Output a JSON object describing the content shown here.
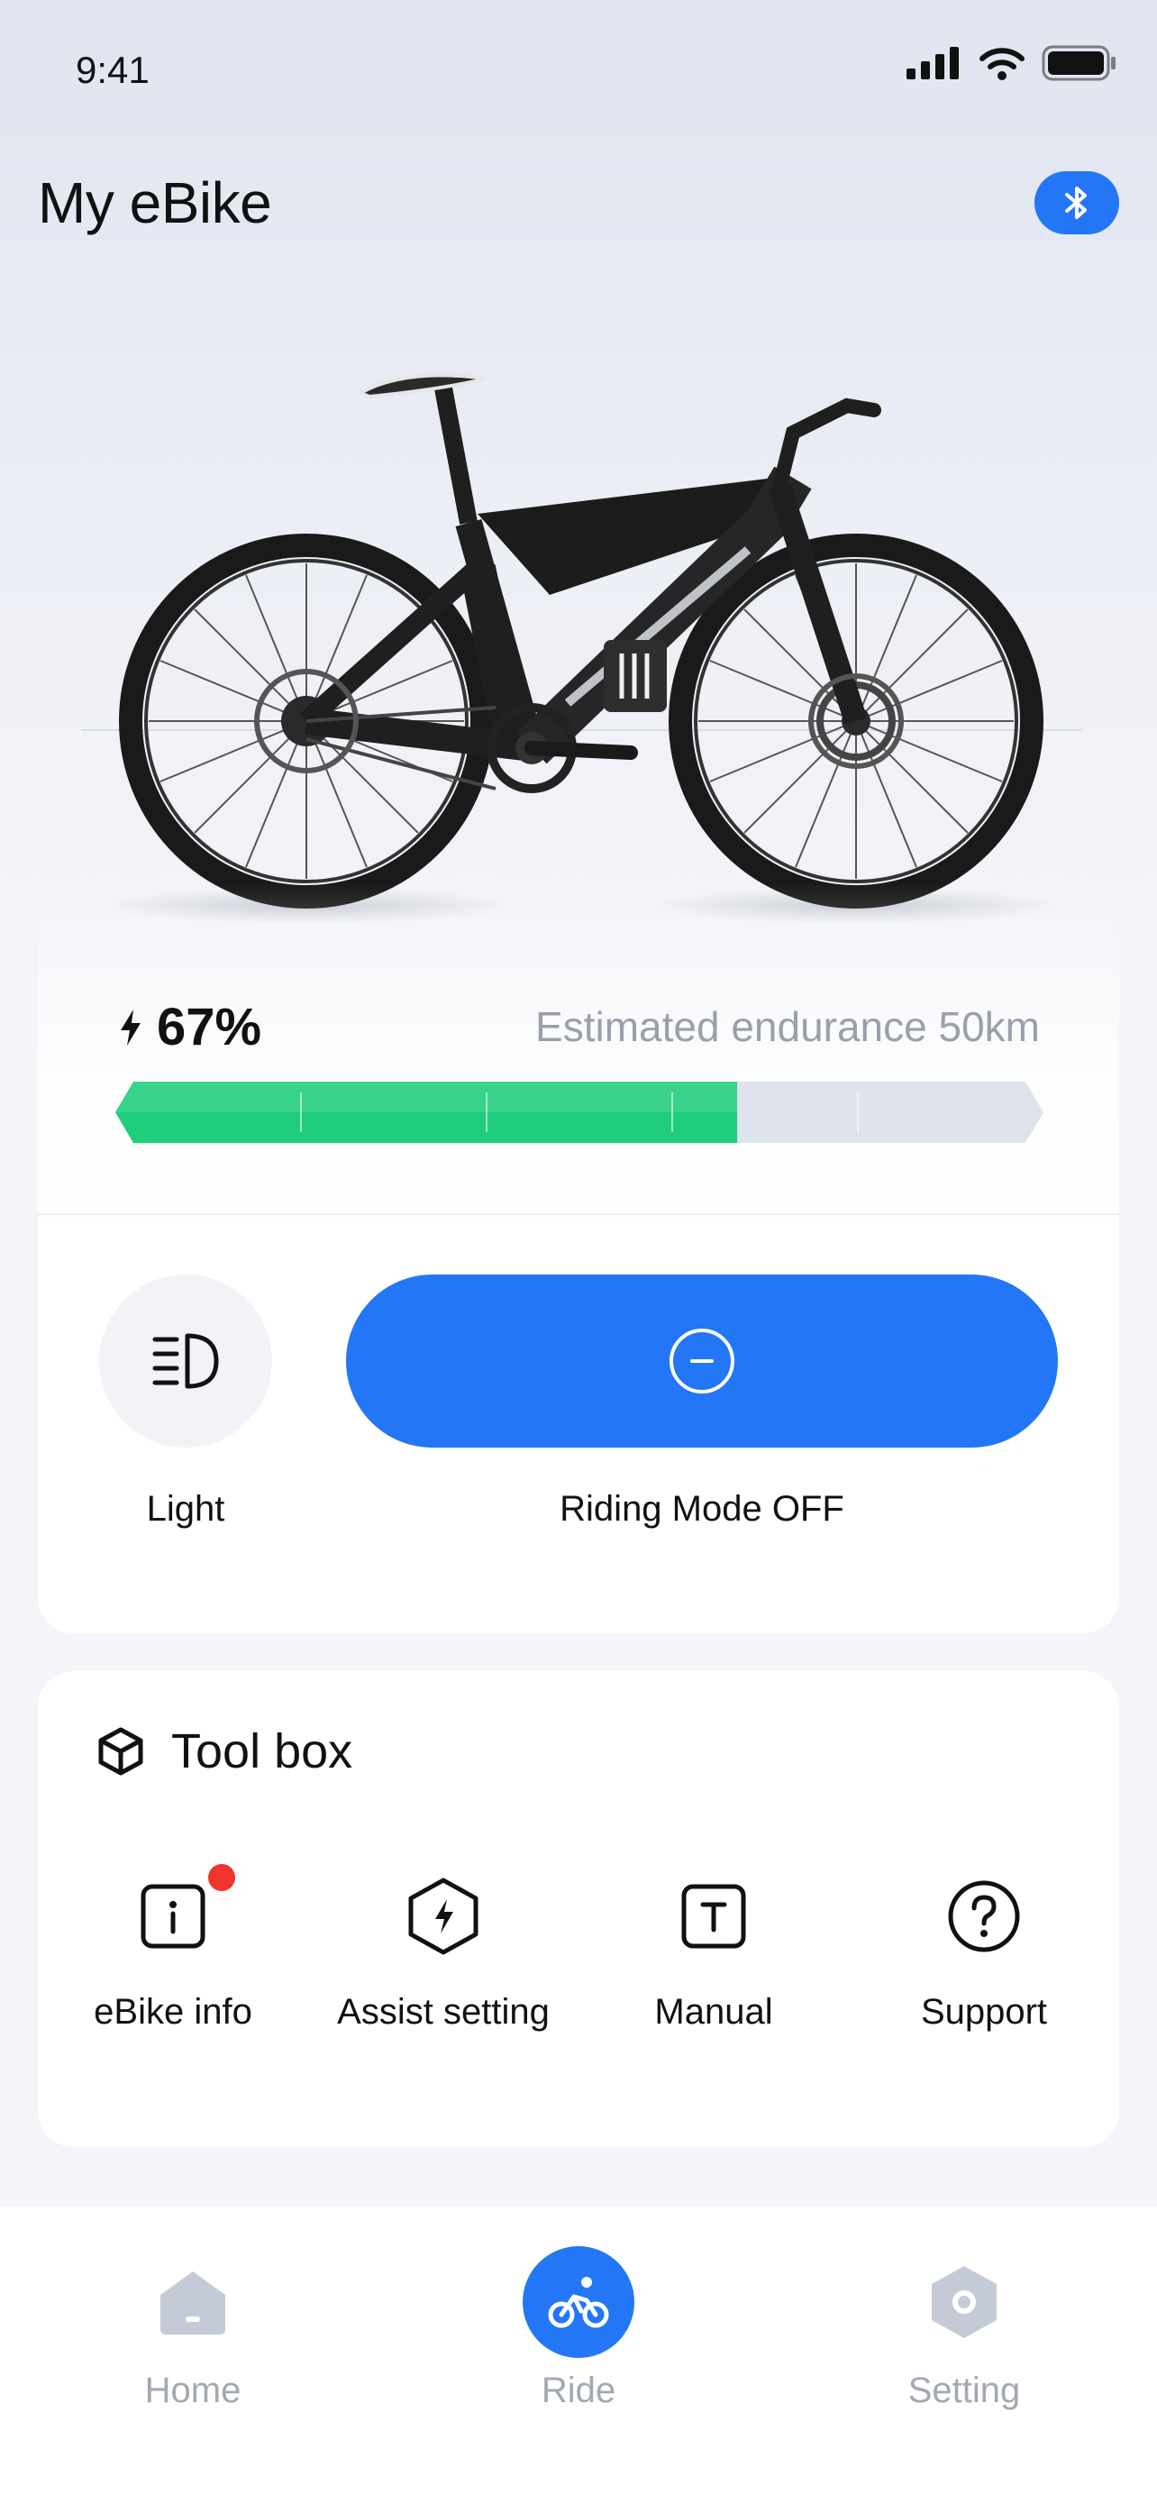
{
  "status": {
    "time": "9:41"
  },
  "header": {
    "title": "My eBike"
  },
  "battery": {
    "percent_text": "67%",
    "level": 0.67,
    "endurance_text": "Estimated endurance 50km",
    "fill_color": "#1fcd7c",
    "empty_color": "#dfe3ec"
  },
  "controls": {
    "light_label": "Light",
    "mode_label": "Riding Mode OFF"
  },
  "toolbox": {
    "title": "Tool box",
    "items": [
      {
        "label": "eBike info",
        "icon": "info-icon",
        "badge": true
      },
      {
        "label": "Assist setting",
        "icon": "bolt-hex-icon"
      },
      {
        "label": "Manual",
        "icon": "manual-icon"
      },
      {
        "label": "Support",
        "icon": "help-icon"
      }
    ]
  },
  "nav": {
    "tabs": [
      {
        "label": "Home",
        "icon": "home-icon"
      },
      {
        "label": "Ride",
        "icon": "bike-icon",
        "active": true
      },
      {
        "label": "Setting",
        "icon": "settings-icon"
      }
    ]
  },
  "colors": {
    "accent": "#2377f6",
    "badge": "#f2322c"
  }
}
